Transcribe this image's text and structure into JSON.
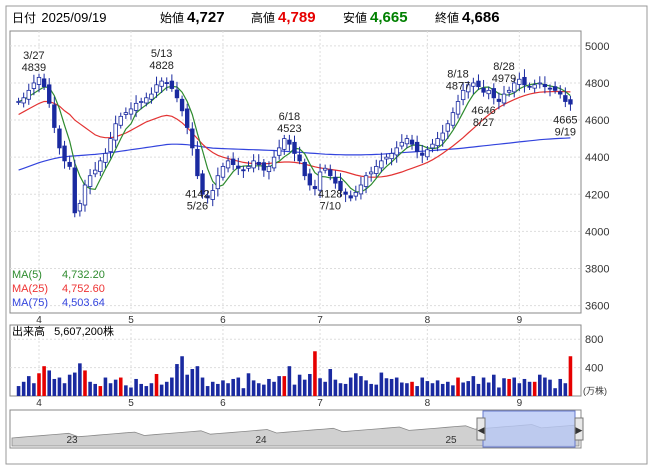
{
  "header": {
    "date_label": "日付",
    "date": "2025/09/19",
    "open_label": "始値",
    "open": "4,727",
    "high_label": "高値",
    "high": "4,789",
    "low_label": "安値",
    "low": "4,665",
    "close_label": "終値",
    "close": "4,686"
  },
  "ma_legend": {
    "ma5_label": "MA(5)",
    "ma5_value": "4,732.20",
    "ma25_label": "MA(25)",
    "ma25_value": "4,752.60",
    "ma75_label": "MA(75)",
    "ma75_value": "4,503.64"
  },
  "volume": {
    "label": "出来高",
    "value": "5,607,200株",
    "unit": "(万株)",
    "ticks": [
      "800",
      "400"
    ]
  },
  "colors": {
    "up": "#e60000",
    "candle": "#1a2aa0",
    "ma5": "#2e8b2e",
    "ma25": "#e33333",
    "ma75": "#3344dd",
    "volume": "#1a2aa0",
    "volume_up": "#e60000"
  },
  "chart_data": [
    {
      "type": "candlestick",
      "title": "",
      "ylim": [
        3560,
        5080
      ],
      "y_ticks": [
        3600,
        3800,
        4000,
        4200,
        4400,
        4600,
        4800,
        5000
      ],
      "x_labels": [
        "4",
        "5",
        "6",
        "7",
        "8",
        "9"
      ],
      "annotations": [
        {
          "date": "3/27",
          "value": "4839"
        },
        {
          "date": "5/13",
          "value": "4828"
        },
        {
          "date": "6/18",
          "value": "4523"
        },
        {
          "date": "8/18",
          "value": "4877"
        },
        {
          "date": "8/28",
          "value": "4979"
        },
        {
          "date": "5/26",
          "value": "4142"
        },
        {
          "date": "7/10",
          "value": "4128"
        },
        {
          "date": "8/27",
          "value": "4646"
        },
        {
          "date": "9/19",
          "value": "4665"
        }
      ],
      "close": [
        4700,
        4720,
        4760,
        4800,
        4830,
        4780,
        4690,
        4560,
        4450,
        4380,
        4350,
        4100,
        4150,
        4250,
        4300,
        4330,
        4380,
        4420,
        4500,
        4580,
        4620,
        4640,
        4660,
        4690,
        4700,
        4720,
        4740,
        4790,
        4810,
        4800,
        4770,
        4720,
        4650,
        4560,
        4450,
        4300,
        4200,
        4180,
        4220,
        4300,
        4350,
        4380,
        4360,
        4340,
        4330,
        4350,
        4380,
        4360,
        4330,
        4350,
        4400,
        4450,
        4500,
        4470,
        4420,
        4380,
        4300,
        4250,
        4230,
        4320,
        4340,
        4300,
        4260,
        4220,
        4200,
        4180,
        4210,
        4250,
        4300,
        4320,
        4350,
        4380,
        4400,
        4420,
        4450,
        4480,
        4500,
        4470,
        4430,
        4410,
        4440,
        4470,
        4500,
        4530,
        4580,
        4640,
        4700,
        4760,
        4790,
        4800,
        4780,
        4750,
        4760,
        4720,
        4700,
        4740,
        4760,
        4800,
        4820,
        4790,
        4780,
        4790,
        4800,
        4780,
        4770,
        4760,
        4740,
        4700,
        4686
      ],
      "ma5": [
        4700,
        4710,
        4727,
        4745,
        4762,
        4778,
        4776,
        4732,
        4662,
        4572,
        4486,
        4368,
        4298,
        4246,
        4230,
        4226,
        4282,
        4336,
        4386,
        4442,
        4500,
        4552,
        4580,
        4638,
        4662,
        4682,
        4702,
        4728,
        4752,
        4776,
        4782,
        4778,
        4750,
        4700,
        4630,
        4528,
        4436,
        4338,
        4270,
        4240,
        4250,
        4286,
        4322,
        4346,
        4352,
        4354,
        4352,
        4354,
        4352,
        4346,
        4364,
        4378,
        4402,
        4420,
        4448,
        4444,
        4418,
        4364,
        4316,
        4296,
        4294,
        4288,
        4290,
        4292,
        4264,
        4232,
        4214,
        4212,
        4228,
        4252,
        4286,
        4322,
        4350,
        4374,
        4400,
        4426,
        4450,
        4464,
        4466,
        4462,
        4450,
        4446,
        4450,
        4470,
        4504,
        4544,
        4590,
        4642,
        4694,
        4738,
        4766,
        4776,
        4778,
        4762,
        4742,
        4734,
        4736,
        4746,
        4768,
        4782,
        4790,
        4796,
        4798,
        4790,
        4784,
        4778,
        4770,
        4754,
        4732
      ],
      "ma25": [
        4630,
        4645,
        4660,
        4675,
        4690,
        4700,
        4700,
        4690,
        4675,
        4650,
        4630,
        4600,
        4580,
        4560,
        4540,
        4520,
        4510,
        4505,
        4505,
        4510,
        4520,
        4530,
        4545,
        4560,
        4575,
        4590,
        4600,
        4610,
        4620,
        4625,
        4620,
        4605,
        4585,
        4560,
        4530,
        4500,
        4470,
        4445,
        4425,
        4410,
        4400,
        4392,
        4385,
        4378,
        4372,
        4368,
        4366,
        4364,
        4365,
        4366,
        4370,
        4372,
        4374,
        4374,
        4372,
        4368,
        4362,
        4355,
        4348,
        4342,
        4338,
        4334,
        4330,
        4326,
        4320,
        4312,
        4304,
        4298,
        4294,
        4292,
        4292,
        4294,
        4298,
        4304,
        4312,
        4320,
        4330,
        4340,
        4350,
        4360,
        4372,
        4386,
        4402,
        4420,
        4440,
        4460,
        4482,
        4505,
        4530,
        4555,
        4580,
        4605,
        4628,
        4650,
        4668,
        4684,
        4698,
        4710,
        4722,
        4732,
        4740,
        4746,
        4750,
        4752,
        4753,
        4754,
        4754,
        4753,
        4752
      ],
      "ma75": [
        4330,
        4340,
        4350,
        4360,
        4370,
        4378,
        4386,
        4392,
        4398,
        4402,
        4405,
        4407,
        4409,
        4411,
        4413,
        4415,
        4418,
        4421,
        4424,
        4428,
        4432,
        4436,
        4440,
        4444,
        4448,
        4452,
        4456,
        4460,
        4464,
        4468,
        4470,
        4470,
        4469,
        4467,
        4464,
        4460,
        4456,
        4452,
        4449,
        4447,
        4446,
        4445,
        4444,
        4443,
        4442,
        4441,
        4440,
        4439,
        4438,
        4437,
        4436,
        4434,
        4432,
        4430,
        4428,
        4426,
        4424,
        4422,
        4420,
        4418,
        4416,
        4415,
        4414,
        4413,
        4412,
        4412,
        4412,
        4412,
        4413,
        4414,
        4415,
        4416,
        4418,
        4420,
        4422,
        4424,
        4426,
        4428,
        4430,
        4432,
        4434,
        4436,
        4438,
        4440,
        4442,
        4444,
        4446,
        4449,
        4452,
        4455,
        4458,
        4461,
        4464,
        4467,
        4470,
        4473,
        4476,
        4479,
        4482,
        4485,
        4488,
        4491,
        4494,
        4496,
        4498,
        4500,
        4501,
        4502,
        4504
      ],
      "volume_ticks": [
        800,
        400
      ],
      "volume_ylim": [
        0,
        1000
      ],
      "volume": [
        140,
        200,
        280,
        180,
        320,
        420,
        360,
        240,
        260,
        180,
        300,
        330,
        460,
        360,
        200,
        170,
        140,
        260,
        180,
        230,
        260,
        150,
        120,
        240,
        170,
        140,
        180,
        310,
        160,
        200,
        260,
        450,
        560,
        300,
        380,
        420,
        260,
        140,
        200,
        170,
        220,
        180,
        240,
        260,
        110,
        320,
        220,
        180,
        160,
        240,
        200,
        280,
        280,
        420,
        160,
        300,
        230,
        310,
        630,
        250,
        200,
        380,
        230,
        180,
        170,
        260,
        320,
        280,
        220,
        170,
        160,
        330,
        250,
        240,
        260,
        190,
        180,
        200,
        140,
        260,
        210,
        180,
        220,
        170,
        200,
        150,
        260,
        190,
        210,
        280,
        170,
        260,
        190,
        300,
        120,
        250,
        240,
        260,
        180,
        240,
        200,
        200,
        300,
        260,
        230,
        110,
        240,
        180,
        560
      ],
      "volume_up": [
        4,
        5,
        13,
        16,
        20,
        27,
        52,
        58,
        77,
        86,
        96,
        101,
        108
      ]
    }
  ],
  "navigator": {
    "labels": [
      "23",
      "24",
      "25"
    ]
  }
}
